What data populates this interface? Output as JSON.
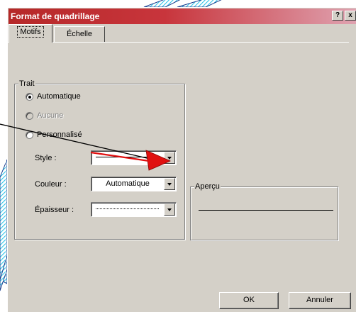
{
  "window": {
    "title": "Format de quadrillage",
    "help_btn": "?",
    "close_btn": "x"
  },
  "tabs": [
    {
      "label": "Motifs",
      "active": true
    },
    {
      "label": "Échelle",
      "active": false
    }
  ],
  "trait": {
    "label": "Trait",
    "options": [
      {
        "label": "Automatique",
        "checked": true,
        "disabled": false
      },
      {
        "label": "Aucune",
        "checked": false,
        "disabled": true
      },
      {
        "label": "Personnalisé",
        "checked": false,
        "disabled": false
      }
    ],
    "fields": {
      "style_label": "Style :",
      "couleur_label": "Couleur :",
      "couleur_value": "Automatique",
      "epaisseur_label": "Épaisseur :"
    }
  },
  "apercu": {
    "label": "Aperçu"
  },
  "buttons": {
    "ok": "OK",
    "cancel": "Annuler"
  },
  "colors": {
    "title_start": "#b62828",
    "title_end": "#dfa2b0",
    "face": "#d4d0c8",
    "annotation_arrow": "#e01010",
    "ribbon": "#2fc4e8"
  },
  "icons": {
    "annotation": "red-arrow-icon",
    "dropdown": "chevron-down-icon"
  }
}
